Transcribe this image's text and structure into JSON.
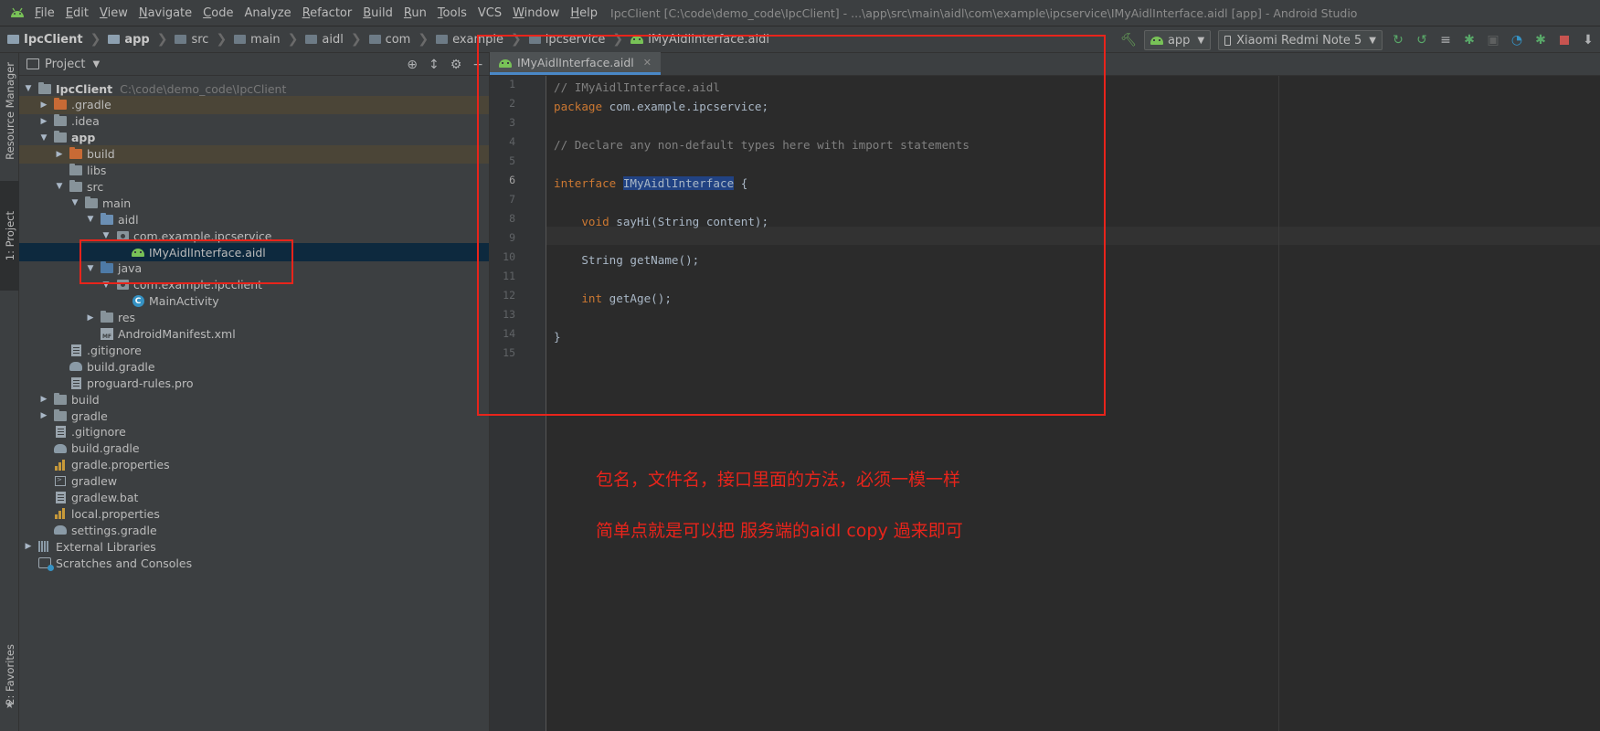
{
  "window": {
    "title": "IpcClient [C:\\code\\demo_code\\IpcClient] - ...\\app\\src\\main\\aidl\\com\\example\\ipcservice\\IMyAidlInterface.aidl [app] - Android Studio"
  },
  "menu": [
    {
      "m": "F",
      "rest": "ile"
    },
    {
      "m": "E",
      "rest": "dit"
    },
    {
      "m": "V",
      "rest": "iew"
    },
    {
      "m": "N",
      "rest": "avigate"
    },
    {
      "m": "C",
      "rest": "ode"
    },
    {
      "m": "",
      "rest": "Analyze"
    },
    {
      "m": "R",
      "rest": "efactor"
    },
    {
      "m": "B",
      "rest": "uild"
    },
    {
      "m": "R",
      "rest": "un"
    },
    {
      "m": "T",
      "rest": "ools"
    },
    {
      "m": "",
      "rest": "VCS"
    },
    {
      "m": "W",
      "rest": "indow"
    },
    {
      "m": "H",
      "rest": "elp"
    }
  ],
  "breadcrumb": [
    "IpcClient",
    "app",
    "src",
    "main",
    "aidl",
    "com",
    "example",
    "ipcservice",
    "IMyAidlInterface.aidl"
  ],
  "toolbar": {
    "run_config": "app",
    "device": "Xiaomi Redmi Note 5"
  },
  "side_tabs": {
    "resource_manager": "Resource Manager",
    "project": "1: Project",
    "favorites": "2: Favorites"
  },
  "project_panel": {
    "view_label": "Project",
    "root_path": "C:\\code\\demo_code\\IpcClient",
    "tree": [
      {
        "label": "IpcClient",
        "bold": true,
        "icon": "folder",
        "arrow": "down",
        "depth": 0
      },
      {
        "label": ".gradle",
        "icon": "folder-orange",
        "arrow": "right",
        "depth": 1
      },
      {
        "label": ".idea",
        "icon": "folder",
        "arrow": "right",
        "depth": 1
      },
      {
        "label": "app",
        "bold": true,
        "icon": "folder",
        "arrow": "down",
        "depth": 1
      },
      {
        "label": "build",
        "icon": "folder-orange",
        "arrow": "right",
        "depth": 2
      },
      {
        "label": "libs",
        "icon": "folder",
        "arrow": "",
        "depth": 2
      },
      {
        "label": "src",
        "icon": "folder",
        "arrow": "down",
        "depth": 2
      },
      {
        "label": "main",
        "icon": "folder",
        "arrow": "down",
        "depth": 3
      },
      {
        "label": "aidl",
        "icon": "folder-blue",
        "arrow": "down",
        "depth": 4
      },
      {
        "label": "com.example.ipcservice",
        "icon": "package",
        "arrow": "down",
        "depth": 5
      },
      {
        "label": "IMyAidlInterface.aidl",
        "icon": "android",
        "arrow": "",
        "depth": 6
      },
      {
        "label": "java",
        "icon": "folder-dkblue",
        "arrow": "down",
        "depth": 4
      },
      {
        "label": "com.example.ipcclient",
        "icon": "package",
        "arrow": "down",
        "depth": 5
      },
      {
        "label": "MainActivity",
        "icon": "class",
        "arrow": "",
        "depth": 6
      },
      {
        "label": "res",
        "icon": "folder",
        "arrow": "right",
        "depth": 4
      },
      {
        "label": "AndroidManifest.xml",
        "icon": "manifest",
        "arrow": "",
        "depth": 4
      },
      {
        "label": ".gitignore",
        "icon": "file",
        "arrow": "",
        "depth": 2
      },
      {
        "label": "build.gradle",
        "icon": "gradle",
        "arrow": "",
        "depth": 2
      },
      {
        "label": "proguard-rules.pro",
        "icon": "file",
        "arrow": "",
        "depth": 2
      },
      {
        "label": "build",
        "icon": "folder",
        "arrow": "right",
        "depth": 1
      },
      {
        "label": "gradle",
        "icon": "folder",
        "arrow": "right",
        "depth": 1
      },
      {
        "label": ".gitignore",
        "icon": "file",
        "arrow": "",
        "depth": 1
      },
      {
        "label": "build.gradle",
        "icon": "gradle",
        "arrow": "",
        "depth": 1
      },
      {
        "label": "gradle.properties",
        "icon": "properties",
        "arrow": "",
        "depth": 1
      },
      {
        "label": "gradlew",
        "icon": "terminal",
        "arrow": "",
        "depth": 1
      },
      {
        "label": "gradlew.bat",
        "icon": "file",
        "arrow": "",
        "depth": 1
      },
      {
        "label": "local.properties",
        "icon": "properties",
        "arrow": "",
        "depth": 1
      },
      {
        "label": "settings.gradle",
        "icon": "gradle",
        "arrow": "",
        "depth": 1
      },
      {
        "label": "External Libraries",
        "icon": "libraries",
        "arrow": "right",
        "depth": 0
      },
      {
        "label": "Scratches and Consoles",
        "icon": "scratch",
        "arrow": "",
        "depth": 0
      }
    ]
  },
  "editor": {
    "tab_label": "IMyAidlInterface.aidl",
    "current_line": 6,
    "line_numbers": [
      "1",
      "2",
      "3",
      "4",
      "5",
      "6",
      "7",
      "8",
      "9",
      "10",
      "11",
      "12",
      "13",
      "14",
      "15"
    ],
    "code": {
      "l1": "// IMyAidlInterface.aidl",
      "l2_kw": "package",
      "l2_rest": " com.example.ipcservice;",
      "l4": "// Declare any non-default types here with import statements",
      "l6_kw": "interface",
      "l6_name": "IMyAidlInterface",
      "l6_rest": " {",
      "l8_kw": "void",
      "l8_rest": " sayHi(String content);",
      "l10_type": "String",
      "l10_rest": " getName();",
      "l12_kw": "int",
      "l12_rest": " getAge();",
      "l14": "}"
    }
  },
  "annotations": {
    "note1": "包名，文件名，接口里面的方法，必须一模一样",
    "note2": "简单点就是可以把 服务端的aidl copy 過来即可"
  },
  "colors": {
    "annotation_red": "#e8241b",
    "selection_blue": "#0d293e",
    "keyword_orange": "#cc7832"
  }
}
